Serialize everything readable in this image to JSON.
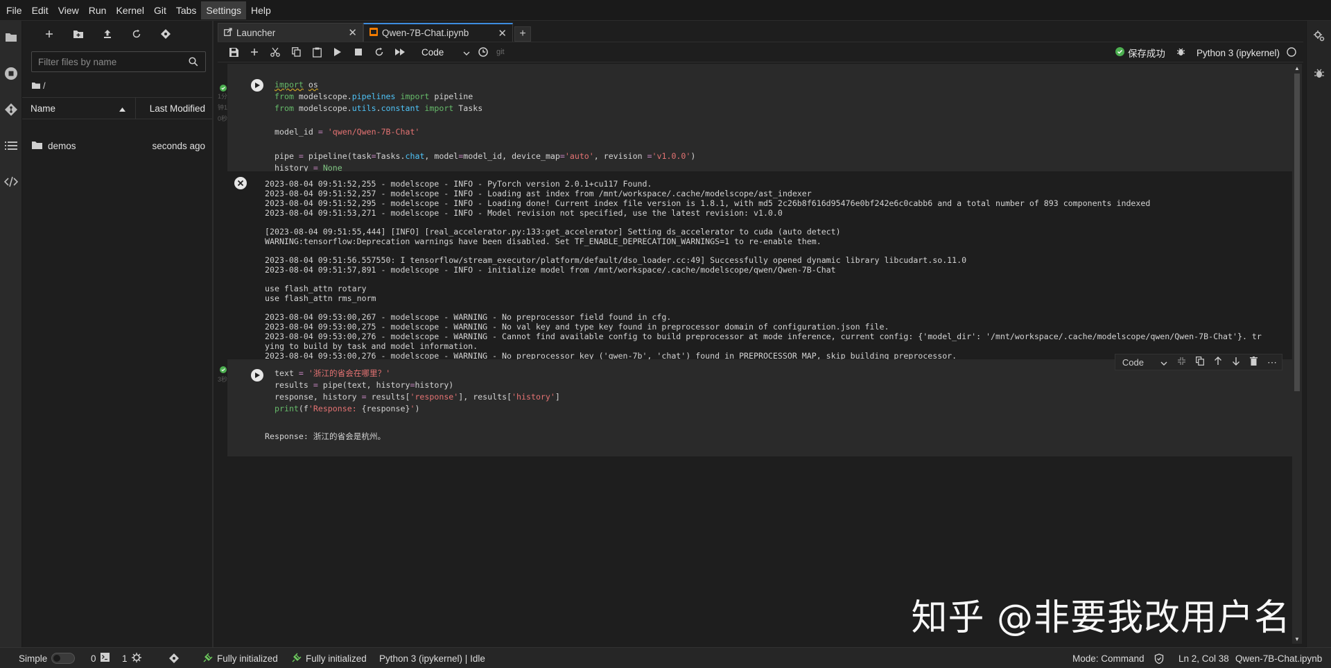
{
  "menubar": {
    "items": [
      "File",
      "Edit",
      "View",
      "Run",
      "Kernel",
      "Git",
      "Tabs",
      "Settings",
      "Help"
    ]
  },
  "filebrowser": {
    "search_placeholder": "Filter files by name",
    "breadcrumb": "/",
    "columns": {
      "name": "Name",
      "modified": "Last Modified"
    },
    "rows": [
      {
        "name": "demos",
        "modified": "seconds ago"
      }
    ]
  },
  "tabs": [
    {
      "label": "Launcher"
    },
    {
      "label": "Qwen-7B-Chat.ipynb"
    }
  ],
  "toolbar": {
    "cell_type": "Code",
    "git_label": "git",
    "save_status": "保存成功",
    "kernel": "Python 3 (ipykernel)"
  },
  "cells": {
    "cell1": {
      "gutter": [
        "1分",
        "钟1",
        "0秒"
      ],
      "lines": [
        "import os",
        "from modelscope.pipelines import pipeline",
        "from modelscope.utils.constant import Tasks",
        "",
        "model_id = 'qwen/Qwen-7B-Chat'",
        "",
        "pipe = pipeline(task=Tasks.chat, model=model_id, device_map='auto', revision ='v1.0.0')",
        "history = None"
      ],
      "output": [
        "2023-08-04 09:51:52,255 - modelscope - INFO - PyTorch version 2.0.1+cu117 Found.",
        "2023-08-04 09:51:52,257 - modelscope - INFO - Loading ast index from /mnt/workspace/.cache/modelscope/ast_indexer",
        "2023-08-04 09:51:52,295 - modelscope - INFO - Loading done! Current index file version is 1.8.1, with md5 2c26b8f616d95476e0bf242e6c0cabb6 and a total number of 893 components indexed",
        "2023-08-04 09:51:53,271 - modelscope - INFO - Model revision not specified, use the latest revision: v1.0.0",
        "",
        "[2023-08-04 09:51:55,444] [INFO] [real_accelerator.py:133:get_accelerator] Setting ds_accelerator to cuda (auto detect)",
        "WARNING:tensorflow:Deprecation warnings have been disabled. Set TF_ENABLE_DEPRECATION_WARNINGS=1 to re-enable them.",
        "",
        "2023-08-04 09:51:56.557550: I tensorflow/stream_executor/platform/default/dso_loader.cc:49] Successfully opened dynamic library libcudart.so.11.0",
        "2023-08-04 09:51:57,891 - modelscope - INFO - initialize model from /mnt/workspace/.cache/modelscope/qwen/Qwen-7B-Chat",
        "",
        "use flash_attn rotary",
        "use flash_attn rms_norm",
        "",
        "2023-08-04 09:53:00,267 - modelscope - WARNING - No preprocessor field found in cfg.",
        "2023-08-04 09:53:00,275 - modelscope - WARNING - No val key and type key found in preprocessor domain of configuration.json file.",
        "2023-08-04 09:53:00,276 - modelscope - WARNING - Cannot find available config to build preprocessor at mode inference, current config: {'model_dir': '/mnt/workspace/.cache/modelscope/qwen/Qwen-7B-Chat'}. tr",
        "ying to build by task and model information.",
        "2023-08-04 09:53:00,276 - modelscope - WARNING - No preprocessor key ('qwen-7b', 'chat') found in PREPROCESSOR_MAP, skip building preprocessor."
      ]
    },
    "cell2": {
      "gutter": "3秒",
      "cell_type": "Code",
      "lines": [
        "text = '浙江的省会在哪里？'",
        "results = pipe(text, history=history)",
        "response, history = results['response'], results['history']",
        "print(f'Response: {response}')"
      ],
      "output": "Response: 浙江的省会是杭州。"
    }
  },
  "statusbar": {
    "mode_simple": "Simple",
    "count_a": "0",
    "count_b": "1",
    "init1": "Fully initialized",
    "init2": "Fully initialized",
    "kernel_status": "Python 3 (ipykernel) | Idle",
    "mode": "Mode: Command",
    "position": "Ln 2, Col 38",
    "filename": "Qwen-7B-Chat.ipynb"
  },
  "watermark": "知乎 @非要我改用户名",
  "colors": {
    "accent": "#3d8de0",
    "success": "#4caf50",
    "string": "#e57373",
    "keyword": "#66bb6a"
  }
}
